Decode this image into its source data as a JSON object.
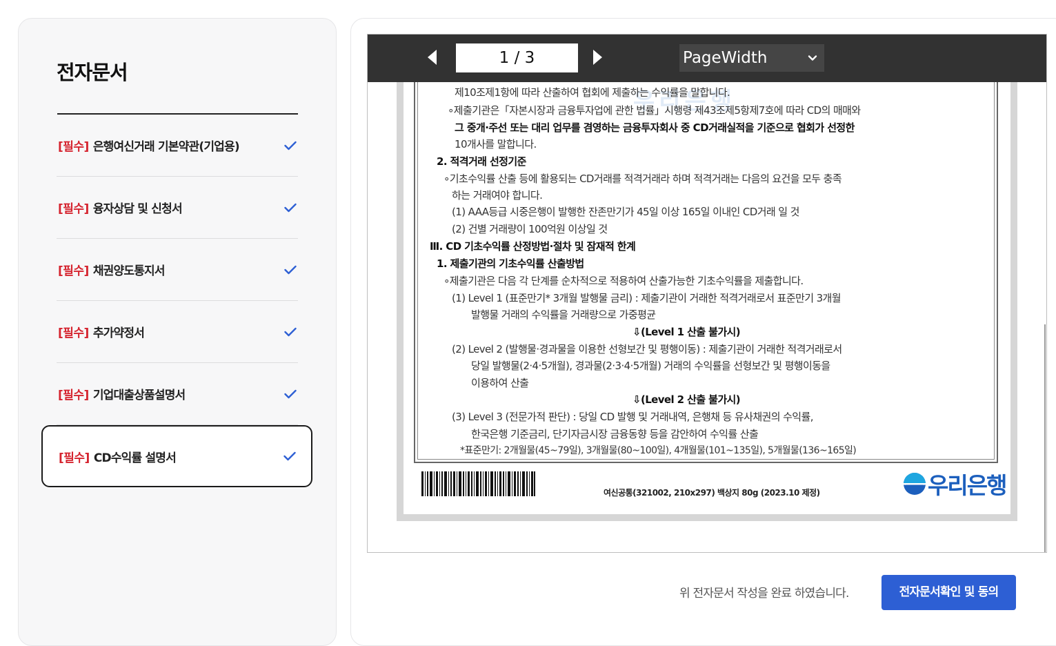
{
  "sidebar": {
    "title": "전자문서",
    "items": [
      {
        "tag": "[필수]",
        "label": "은행여신거래 기본약관(기업용)",
        "checked": true,
        "active": false
      },
      {
        "tag": "[필수]",
        "label": "융자상담 및 신청서",
        "checked": true,
        "active": false
      },
      {
        "tag": "[필수]",
        "label": "채권양도통지서",
        "checked": true,
        "active": false
      },
      {
        "tag": "[필수]",
        "label": "추가약정서",
        "checked": true,
        "active": false
      },
      {
        "tag": "[필수]",
        "label": "기업대출상품설명서",
        "checked": true,
        "active": false
      },
      {
        "tag": "[필수]",
        "label": "CD수익률 설명서",
        "checked": true,
        "active": true
      }
    ]
  },
  "viewer": {
    "page_indicator": "1 / 3",
    "zoom": "PageWidth"
  },
  "document": {
    "lines": [
      "제10조제1항에 따라 산출하여 협회에 제출하는 수익률을 말합니다.",
      "∘제출기관은「자본시장과 금융투자업에 관한 법률」시행령 제43조제5항제7호에 따라 CD의 매매와",
      "그 중개·주선 또는 대리 업무를 겸영하는 금융투자회사 중 CD거래실적을 기준으로 협회가 선정한",
      "10개사를 말합니다.",
      "2. 적격거래 선정기준",
      "∘기초수익률 산출 등에 활용되는 CD거래를 적격거래라 하며 적격거래는 다음의 요건을 모두 충족",
      "하는 거래여야 합니다.",
      "(1) AAA등급 시중은행이 발행한 잔존만기가 45일 이상 165일 이내인 CD거래 일 것",
      "(2) 건별 거래량이 100억원 이상일 것",
      "Ⅲ. CD 기초수익률 산정방법·절차 및 잠재적 한계",
      "1. 제출기관의 기초수익률 산출방법",
      "∘제출기관은 다음 각 단계를 순차적으로 적용하여 산출가능한 기초수익률을 제출합니다.",
      "(1) Level 1 (표준만기* 3개월 발행물 금리) : 제출기관이 거래한 적격거래로서 표준만기 3개월",
      "발행물 거래의 수익률을 거래량으로 가중평균",
      "⇩(Level 1 산출 불가시)",
      "(2) Level 2 (발행물·경과물을 이용한 선형보간 및 평행이동) : 제출기관이 거래한 적격거래로서",
      "당일 발행물(2·4·5개월), 경과물(2·3·4·5개월) 거래의 수익률을 선형보간 및 평행이동을",
      "이용하여 산출",
      "⇩(Level 2 산출 불가시)",
      "(3) Level 3 (전문가적 판단) : 당일 CD 발행 및 거래내역, 은행채 등 유사채권의 수익률,",
      "한국은행 기준금리, 단기자금시장 금융동향 등을 감안하여 수익률 산출",
      "*표준만기: 2개월물(45~79일), 3개월물(80~100일), 4개월물(101~135일), 5개월물(136~165일)"
    ],
    "footer_code": "여신공통(321002, 210x297) 백상지 80g (2023.10 제정)",
    "bank_name": "우리은행"
  },
  "footer": {
    "message": "위 전자문서 작성을 완료 하였습니다.",
    "confirm_label": "전자문서확인 및 동의"
  },
  "colors": {
    "required_tag": "#d5232e",
    "check": "#2d5fd4",
    "primary_button": "#2d5fd4",
    "toolbar": "#323232",
    "bank_brand": "#1c5fbd"
  }
}
